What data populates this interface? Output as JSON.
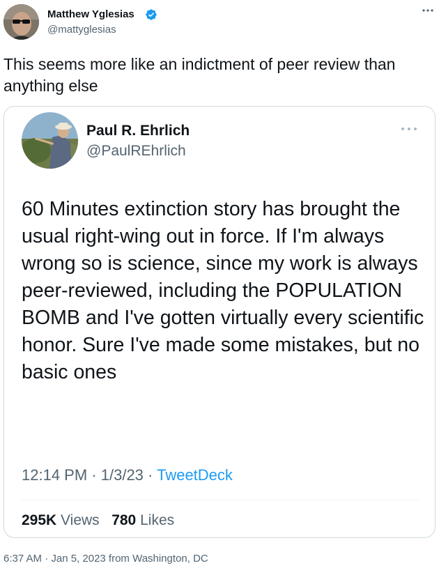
{
  "tweet": {
    "author": {
      "name": "Matthew Yglesias",
      "handle": "@mattyglesias",
      "verified": true
    },
    "text": "This seems more like an indictment of peer review than anything else",
    "meta": "6:37 AM · Jan 5, 2023 from Washington, DC"
  },
  "quoted_tweet": {
    "author": {
      "name": "Paul R. Ehrlich",
      "handle": "@PaulREhrlich"
    },
    "text": "60 Minutes extinction story has brought the usual right-wing out in force.  If I'm always wrong so is science, since my work is always peer-reviewed, including the POPULATION BOMB and I've gotten virtually every scientific honor. Sure I've made some mistakes, but no basic ones",
    "time": "12:14 PM",
    "date": "1/3/23",
    "separator": "·",
    "source": "TweetDeck",
    "views_count": "295K",
    "views_label": "Views",
    "likes_count": "780",
    "likes_label": "Likes"
  },
  "icons": {
    "more": "more-dots-icon",
    "verified": "verified-badge-icon"
  },
  "colors": {
    "text": "#0f1419",
    "secondary": "#536471",
    "accent": "#1d9bf0",
    "border": "#cfd9de"
  }
}
